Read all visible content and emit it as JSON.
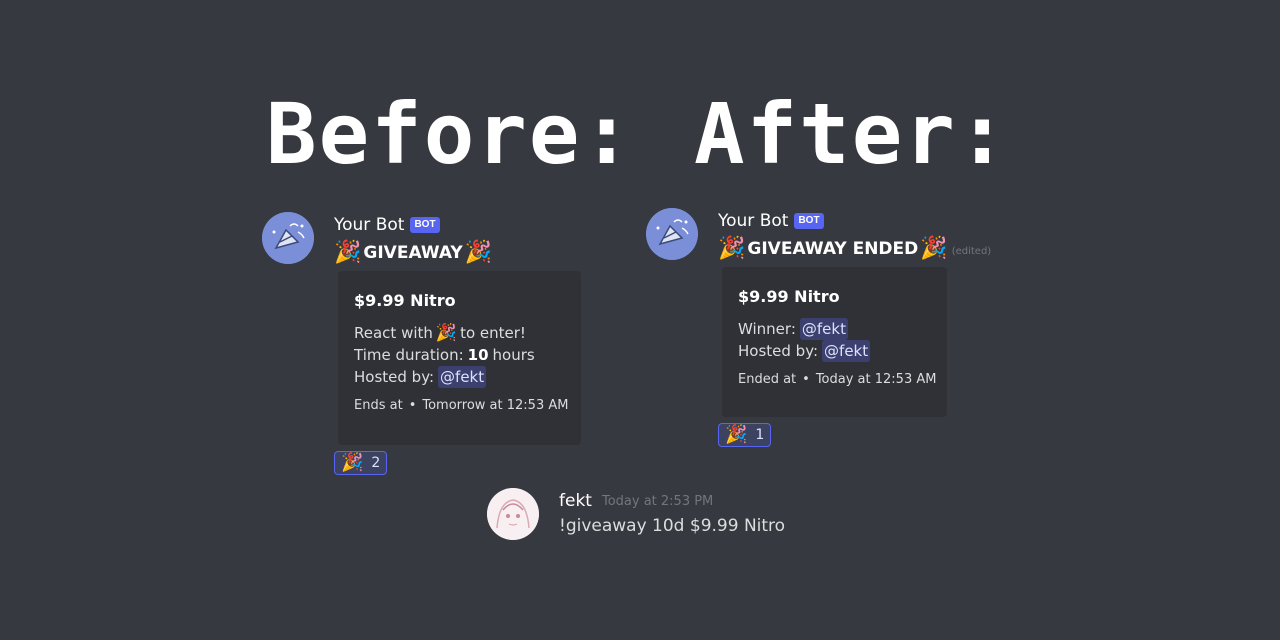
{
  "headings": {
    "before": "Before:",
    "after": "After:"
  },
  "icons": {
    "popper": "🎉",
    "bot_avatar": "party-popper-avatar-icon",
    "user_avatar": "anime-avatar-icon"
  },
  "colors": {
    "background": "#36393f",
    "embed": "#2f3136",
    "bot_tag": "#5865f2",
    "mention": "#dee0fc"
  },
  "before": {
    "username": "Your Bot",
    "bot_tag": "BOT",
    "title": "GIVEAWAY",
    "embed": {
      "title": "$9.99 Nitro",
      "line1_prefix": "React with",
      "line1_suffix": "to enter!",
      "line2_prefix": "Time duration:",
      "line2_value": "10",
      "line2_suffix": "hours",
      "line3_prefix": "Hosted by:",
      "line3_mention": "@fekt",
      "footer_label": "Ends at",
      "footer_sep": "•",
      "footer_time": "Tomorrow at 12:53 AM"
    },
    "reaction_count": "2"
  },
  "after": {
    "username": "Your Bot",
    "bot_tag": "BOT",
    "title": "GIVEAWAY ENDED",
    "edited": "(edited)",
    "embed": {
      "title": "$9.99 Nitro",
      "line1_prefix": "Winner:",
      "line1_mention": "@fekt",
      "line2_prefix": "Hosted by:",
      "line2_mention": "@fekt",
      "footer_label": "Ended at",
      "footer_sep": "•",
      "footer_time": "Today at 12:53 AM"
    },
    "reaction_count": "1"
  },
  "user_message": {
    "username": "fekt",
    "timestamp": "Today at 2:53 PM",
    "text": "!giveaway 10d $9.99 Nitro"
  }
}
